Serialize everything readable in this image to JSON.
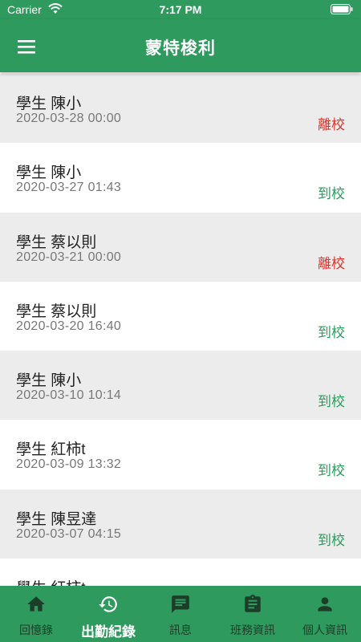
{
  "status_bar": {
    "carrier": "Carrier",
    "time": "7:17 PM"
  },
  "header": {
    "title": "蒙特梭利",
    "menu_icon": "hamburger-menu-icon"
  },
  "records": [
    {
      "name": "學生 陳小",
      "time": "2020-03-28 00:00",
      "status": "離校",
      "type": "leave"
    },
    {
      "name": "學生 陳小",
      "time": "2020-03-27 01:43",
      "status": "到校",
      "type": "arrive"
    },
    {
      "name": "學生 蔡以則",
      "time": "2020-03-21 00:00",
      "status": "離校",
      "type": "leave"
    },
    {
      "name": "學生 蔡以則",
      "time": "2020-03-20 16:40",
      "status": "到校",
      "type": "arrive"
    },
    {
      "name": "學生 陳小",
      "time": "2020-03-10 10:14",
      "status": "到校",
      "type": "arrive"
    },
    {
      "name": "學生 紅柿t",
      "time": "2020-03-09 13:32",
      "status": "到校",
      "type": "arrive"
    },
    {
      "name": "學生 陳昱達",
      "time": "2020-03-07 04:15",
      "status": "到校",
      "type": "arrive"
    },
    {
      "name": "學生 紅柿t",
      "time": "",
      "status": "",
      "type": "arrive"
    }
  ],
  "tabs": [
    {
      "label": "回憶錄",
      "icon": "home-icon",
      "active": false
    },
    {
      "label": "出勤紀錄",
      "icon": "history-icon",
      "active": true
    },
    {
      "label": "訊息",
      "icon": "message-icon",
      "active": false
    },
    {
      "label": "班務資訊",
      "icon": "clipboard-icon",
      "active": false
    },
    {
      "label": "個人資訊",
      "icon": "person-icon",
      "active": false
    }
  ],
  "colors": {
    "primary": "#2e9a5e",
    "leave": "#d9342b",
    "arrive": "#2e9a5e",
    "shaded_row": "#ececec"
  }
}
